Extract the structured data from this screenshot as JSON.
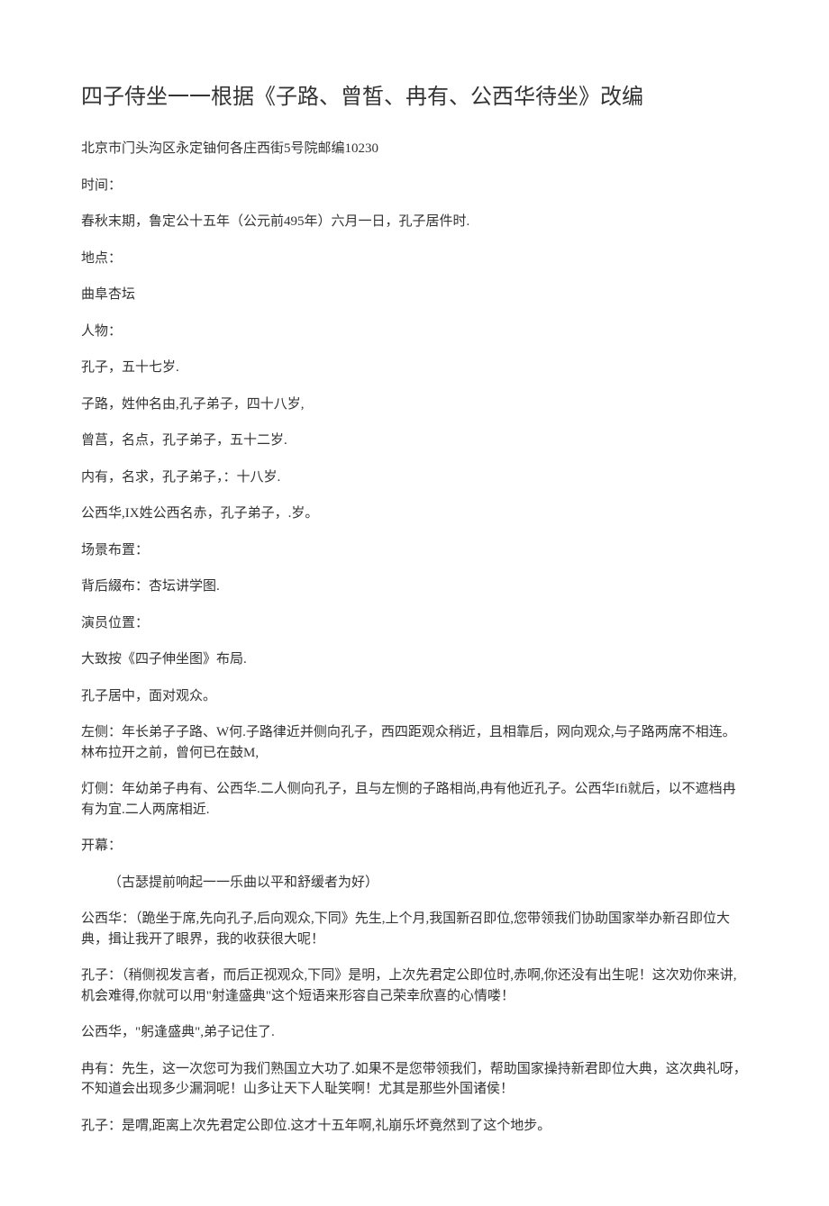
{
  "title": "四子侍坐一一根据《子路、曾皙、冉有、公西华待坐》改编",
  "address": "北京市门头沟区永定铀何各庄西街5号院邮编10230",
  "timeLabel": "时间：",
  "timeText": "春秋末期，鲁定公十五年（公元前495年）六月一日，孔子居件时.",
  "placeLabel": "地点：",
  "placeText": "曲阜杏坛",
  "charLabel": "人物：",
  "char1": "孔子，五十七岁.",
  "char2": "子路，姓仲名由,孔子弟子，四十八岁,",
  "char3": "曾莒，名点，孔子弟子，五十二岁.",
  "char4": "内有，名求，孔子弟子，：十八岁.",
  "char5": "公西华,IX姓公西名赤，孔子弟子，.岁。",
  "sceneLabel": "场景布置：",
  "sceneText": "背后綴布：杏坛讲学图.",
  "actorLabel": "演员位置：",
  "actorText": "大致按《四子伸坐图》布局.",
  "pos1": "孔子居中，面对观众。",
  "pos2": "左侧：年长弟子子路、W何.子路律近并侧向孔子，西四距观众稍近，且相靠后，网向观众,与子路两席不相连。林布拉开之前，曾何已在鼓M,",
  "pos3": "灯侧：年幼弟子冉有、公西华.二人侧向孔子，且与左恻的子路相尚,冉有他近孔子。公西华Ifi就后，以不遮档冉有为宜.二人两席相近.",
  "openLabel": "开幕：",
  "openNote": "（古瑟提前响起一一乐曲以平和舒缓者为好）",
  "line1": "公西华：（跪坐于席,先向孔子,后向观众,下同》先生,上个月,我国新召即位,您带领我们协助国家举办新召即位大典，揖让我开了眼界，我的收获很大呢！",
  "line2": "孔子：（稍侧视发言者，而后正视观众,下同》是明，上次先君定公即位时,赤啊,你还没有出生呢！这次劝你来讲,机会难得,你就可以用\"射逢盛典\"这个短语来形容自己荣幸欣喜的心情喽！",
  "line3": "公西华，\"躬逢盛典\",弟子记住了.",
  "line4": "冉有：先生，这一次您可为我们熟国立大功了.如果不是您带领我们，帮助国家操持新君即位大典，这次典礼呀，不知道会出现多少漏洞呢！山多让天下人耻笑啊！尤其是那些外国诸侯！",
  "line5": "孔子：是喟,距离上次先君定公即位.这才十五年啊,礼崩乐坏竟然到了这个地步。"
}
